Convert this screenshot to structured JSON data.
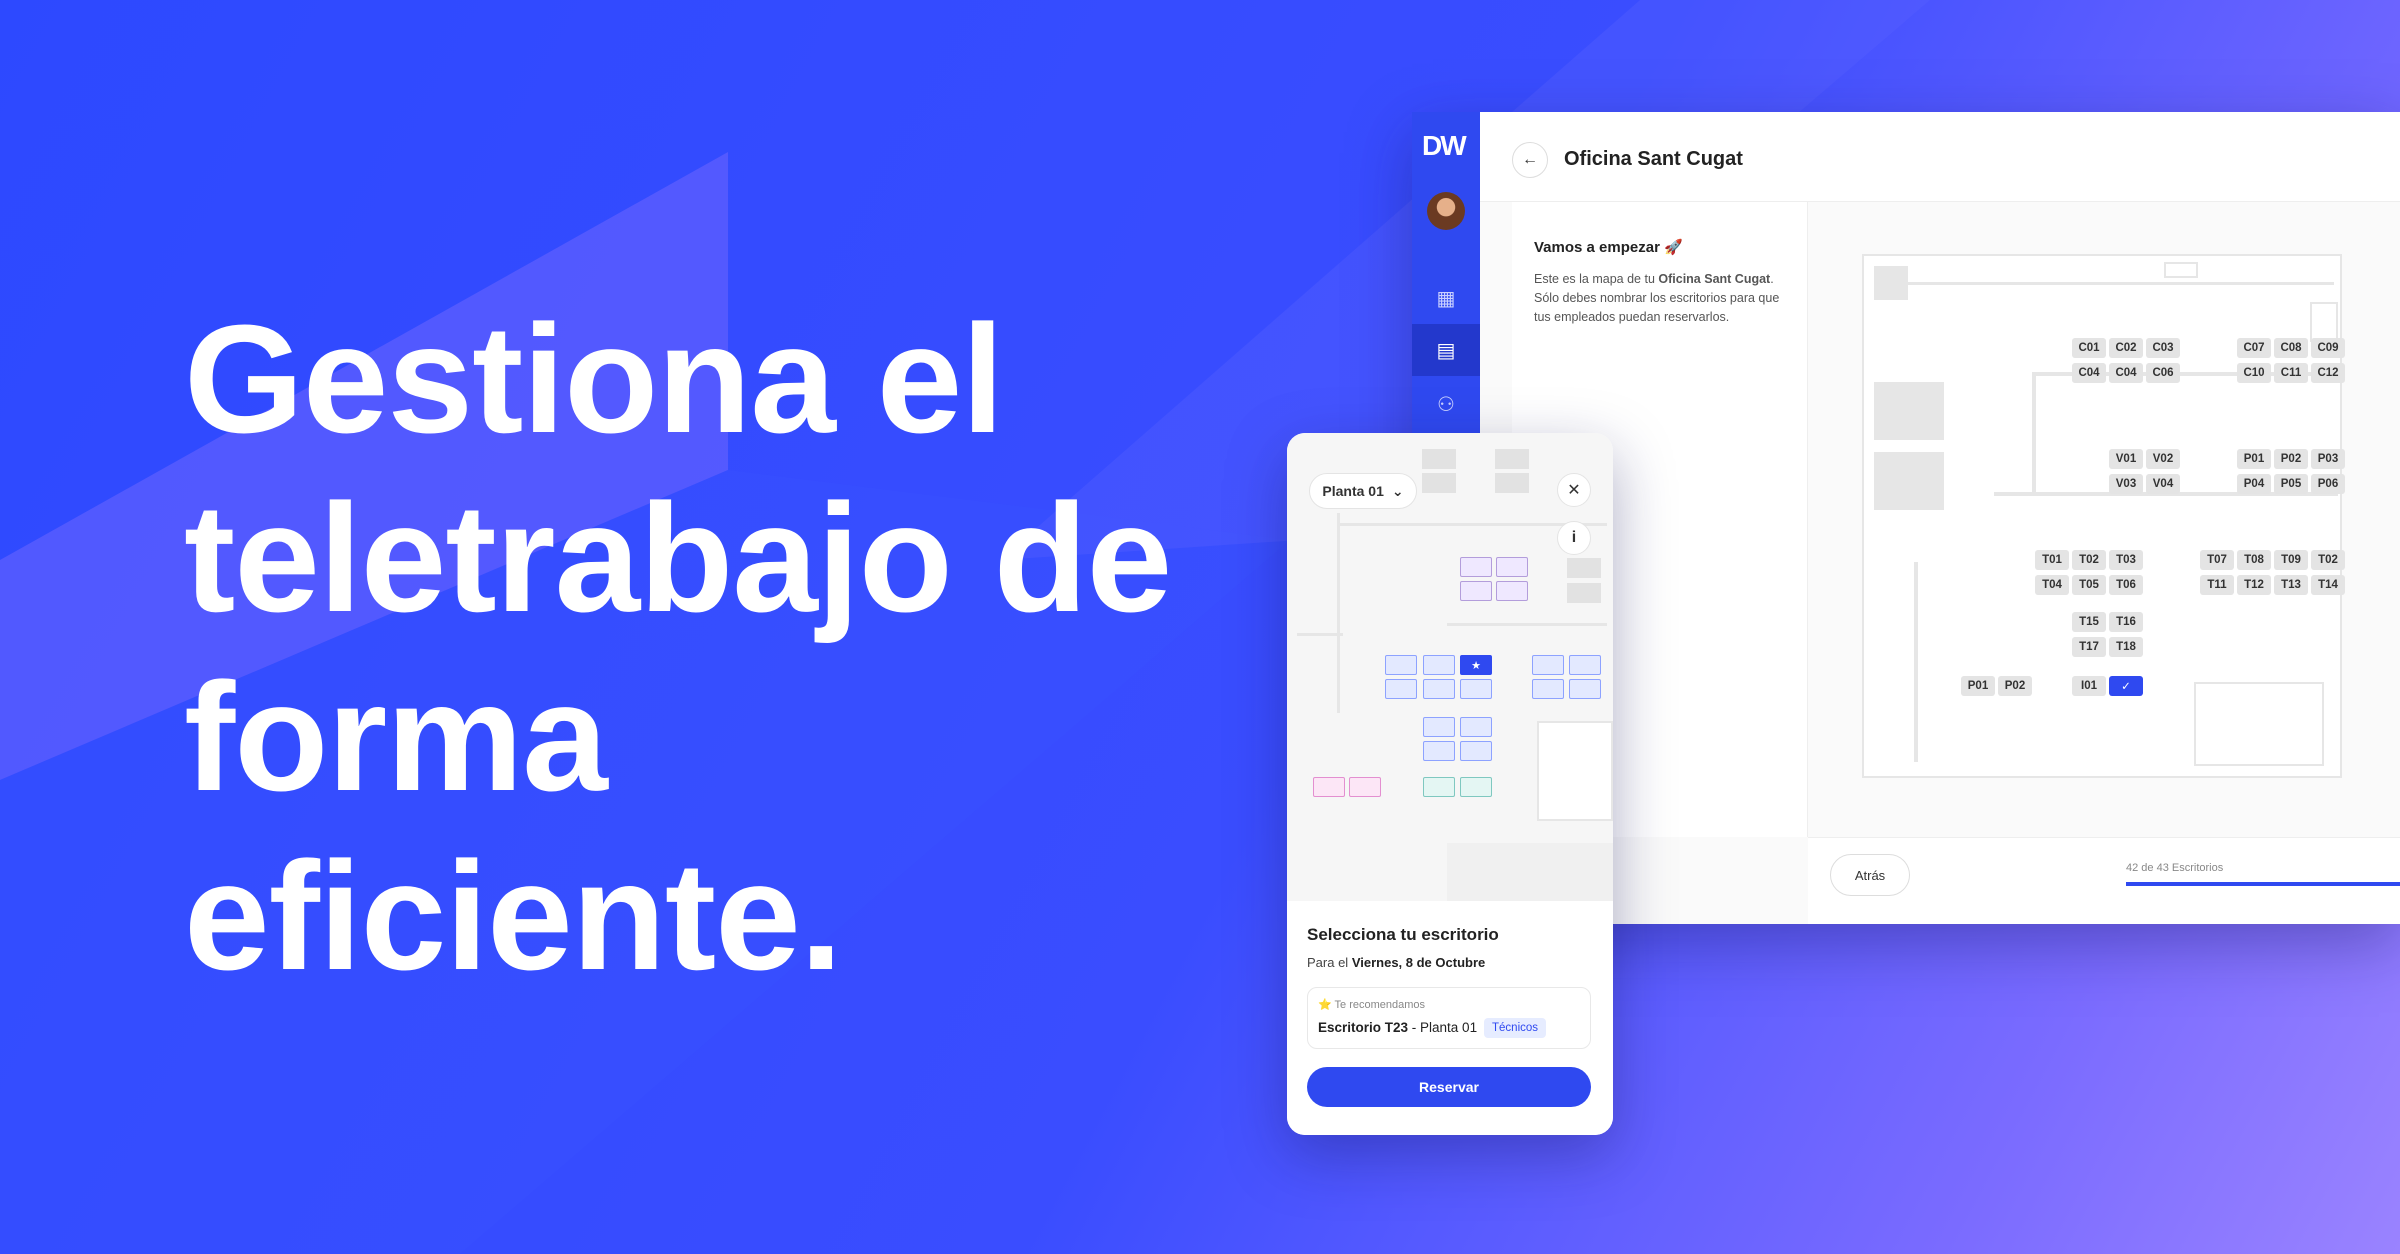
{
  "hero": {
    "line1": "Gestiona el",
    "line2": "teletrabajo de",
    "line3": "forma",
    "line4": "eficiente."
  },
  "desktop": {
    "logo": "DW",
    "nav_icons": [
      "dashboard-icon",
      "building-icon",
      "users-icon",
      "home-icon"
    ],
    "back_icon": "←",
    "title": "Oficina Sant Cugat",
    "intro_title": "Vamos a empezar 🚀",
    "intro_text_1": "Este es la mapa de tu ",
    "intro_text_bold": "Oficina Sant Cugat",
    "intro_text_2": ". Sólo debes nombrar los escritorios para que tus empleados puedan reservarlos.",
    "desks": [
      "C01",
      "C02",
      "C03",
      "C07",
      "C08",
      "C09",
      "C04",
      "C04",
      "C06",
      "C10",
      "C11",
      "C12",
      "V01",
      "V02",
      "P01",
      "P02",
      "P03",
      "V03",
      "V04",
      "P04",
      "P05",
      "P06",
      "T01",
      "T02",
      "T03",
      "T07",
      "T08",
      "T09",
      "T02",
      "T04",
      "T05",
      "T06",
      "T11",
      "T12",
      "T13",
      "T14",
      "T15",
      "T16",
      "T17",
      "T18",
      "P01",
      "P02",
      "I01"
    ],
    "selected_check": "✓",
    "back_button": "Atrás",
    "progress_text": "42 de 43 Escritorios",
    "progress": 0.98
  },
  "mobile": {
    "floor_select": "Planta 01",
    "chevron": "⌄",
    "close_icon": "✕",
    "info_icon": "i",
    "star": "★",
    "sheet_title": "Selecciona tu escritorio",
    "sheet_sub_prefix": "Para el ",
    "sheet_sub_date": "Viernes, 8 de Octubre",
    "recommend_label": "⭐ Te recomendamos",
    "rec_desk": "Escritorio T23",
    "rec_floor": " - Planta 01",
    "rec_tag": "Técnicos",
    "reserve_button": "Reservar"
  },
  "colors": {
    "accent": "#2f49f0",
    "bg_start": "#2d49ff",
    "bg_end": "#9a83ff"
  }
}
